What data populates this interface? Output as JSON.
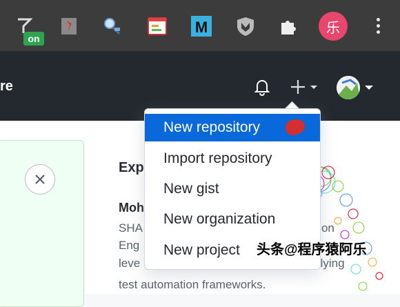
{
  "browser_toolbar": {
    "extensions": [
      {
        "icon": "screenshot-extension-icon"
      },
      {
        "icon": "red-figure-extension-icon"
      },
      {
        "icon": "satellite-extension-icon"
      },
      {
        "icon": "notes-extension-icon"
      },
      {
        "icon": "m-extension-icon",
        "label": "M"
      },
      {
        "icon": "shield-extension-icon"
      },
      {
        "icon": "puzzle-icon"
      }
    ],
    "on_badge": "on",
    "profile_initial": "乐",
    "accent": "#e8466d"
  },
  "github_header": {
    "title_fragment": "re"
  },
  "dropdown": {
    "items": [
      {
        "label": "New repository",
        "active": true
      },
      {
        "label": "Import repository"
      },
      {
        "label": "New gist"
      },
      {
        "label": "New organization"
      },
      {
        "label": "New project"
      }
    ],
    "active_color": "#0969da"
  },
  "content": {
    "explore_title": "Exp",
    "post_author": "Moh",
    "post_lines": [
      "SHA",
      "Eng",
      "leve"
    ],
    "post_line_suffixes": [
      "ation",
      "",
      "derlying"
    ],
    "post_tail": "test automation frameworks."
  },
  "watermark": "头条@程序猿阿乐"
}
